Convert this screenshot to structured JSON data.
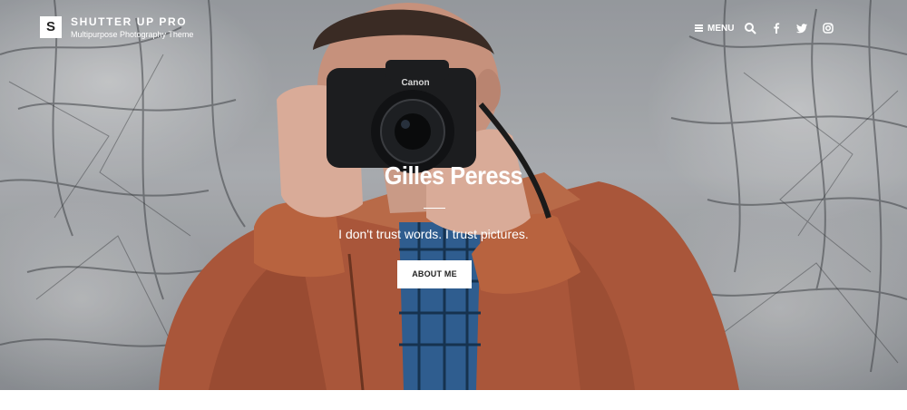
{
  "header": {
    "logo_letter": "S",
    "site_title": "SHUTTER UP PRO",
    "tagline": "Multipurpose Photography Theme",
    "menu_label": "MENU",
    "icons": [
      "hamburger-icon",
      "search-icon",
      "facebook-icon",
      "twitter-icon",
      "instagram-icon"
    ]
  },
  "hero": {
    "title": "Gilles Peress",
    "quote": "I don't trust words. I trust pictures.",
    "button_label": "ABOUT ME",
    "colors": {
      "jacket": "#b5603c",
      "overlay_text": "#ffffff",
      "button_bg": "#ffffff",
      "button_text": "#222222"
    }
  }
}
